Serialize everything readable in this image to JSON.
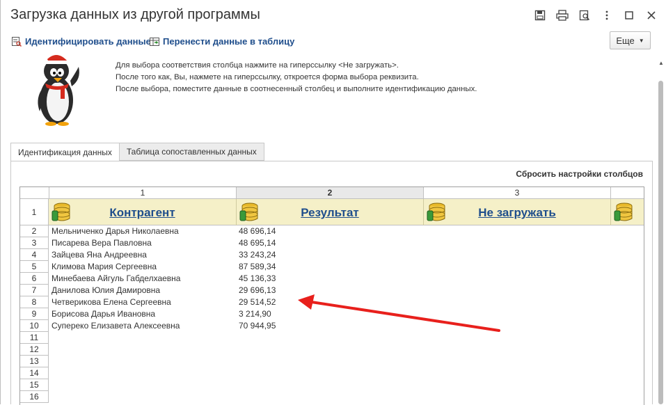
{
  "window": {
    "title": "Загрузка данных из другой программы",
    "buttons": [
      "save-icon",
      "print-icon",
      "preview-icon",
      "more-vert-icon",
      "maximize-icon",
      "close-icon"
    ]
  },
  "commands": {
    "identify": "Идентифицировать данные",
    "transfer": "Перенести данные в таблицу",
    "more": "Еще"
  },
  "info": {
    "line1": "Для выбора соответствия столбца нажмите на гиперссылку <Не загружать>.",
    "line2": "После того как, Вы, нажмете на гиперссылку, откроется форма выбора реквизита.",
    "line3": "После выбора, поместите данные в соотнесенный столбец и выполните идентификацию данных."
  },
  "tabs": {
    "active": "Идентификация данных",
    "inactive": "Таблица сопоставленных данных"
  },
  "reset_columns": "Сбросить настройки столбцов",
  "grid": {
    "column_numbers": [
      "1",
      "2",
      "3"
    ],
    "header_row_number": "1",
    "column_headers": [
      "Контрагент",
      "Результат",
      "Не загружать"
    ],
    "rows": [
      {
        "n": "2",
        "name": "Мельниченко Дарья Николаевна",
        "value": "48 696,14"
      },
      {
        "n": "3",
        "name": "Писарева Вера Павловна",
        "value": "48 695,14"
      },
      {
        "n": "4",
        "name": "Зайцева Яна Андреевна",
        "value": "33 243,24"
      },
      {
        "n": "5",
        "name": "Климова Мария Сергеевна",
        "value": "87 589,34"
      },
      {
        "n": "6",
        "name": "Минебаева Айгуль Габделхаевна",
        "value": "45 136,33"
      },
      {
        "n": "7",
        "name": "Данилова Юлия Дамировна",
        "value": "29 696,13"
      },
      {
        "n": "8",
        "name": "Четверикова Елена Сергеевна",
        "value": "29 514,52"
      },
      {
        "n": "9",
        "name": "Борисова Дарья Ивановна",
        "value": "3 214,90"
      },
      {
        "n": "10",
        "name": "Супереко Елизавета Алексеевна",
        "value": "70 944,95"
      },
      {
        "n": "11",
        "name": "",
        "value": ""
      },
      {
        "n": "12",
        "name": "",
        "value": ""
      },
      {
        "n": "13",
        "name": "",
        "value": ""
      },
      {
        "n": "14",
        "name": "",
        "value": ""
      },
      {
        "n": "15",
        "name": "",
        "value": ""
      },
      {
        "n": "16",
        "name": "",
        "value": ""
      }
    ]
  },
  "colors": {
    "link": "#1f4e8c",
    "header_bg": "#f5f0c8",
    "arrow": "#e8201c"
  }
}
